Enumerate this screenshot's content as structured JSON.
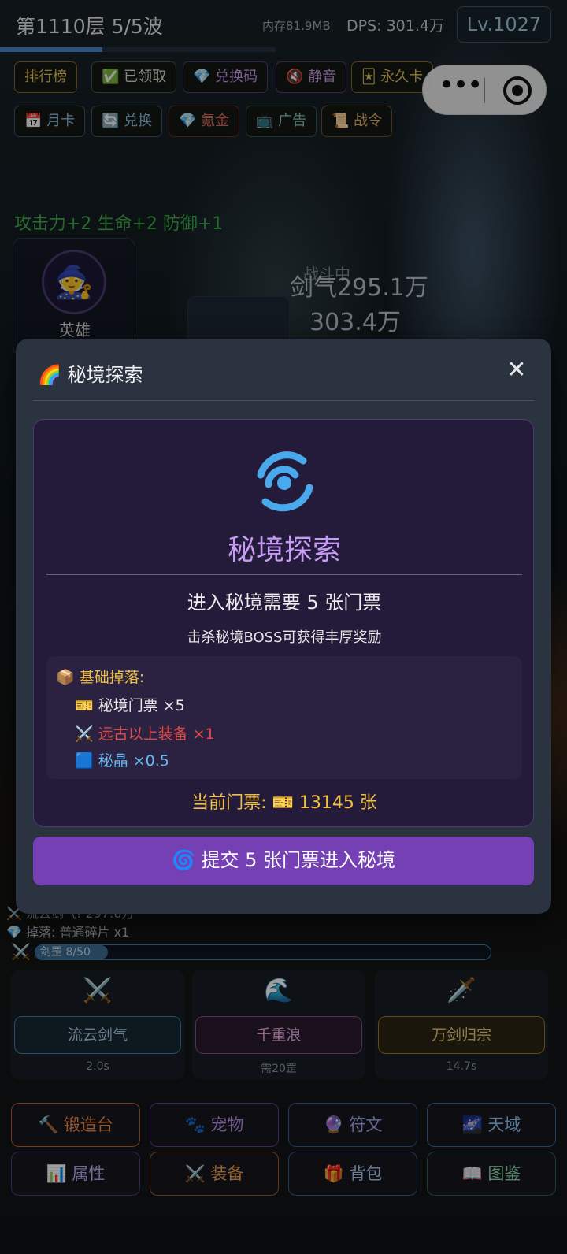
{
  "header": {
    "floor": "第1110层  5/5波",
    "memory": "内存81.9MB",
    "dps": "DPS: 301.4万",
    "level": "Lv.1027",
    "wave_progress": 0.37
  },
  "toolbar_row1": [
    {
      "label": "排行榜",
      "icon": ""
    },
    {
      "label": "已领取",
      "icon": "✅"
    },
    {
      "label": "兑换码",
      "icon": "💎"
    },
    {
      "label": "静音",
      "icon": "🔇"
    },
    {
      "label": "永久卡",
      "icon": "🃏"
    }
  ],
  "toolbar_row2": [
    {
      "label": "月卡",
      "icon": "📅"
    },
    {
      "label": "兑换",
      "icon": "🔄"
    },
    {
      "label": "氪金",
      "icon": "💎"
    },
    {
      "label": "广告",
      "icon": "📺"
    },
    {
      "label": "战令",
      "icon": "📜"
    }
  ],
  "mini_program": {
    "more_icon": "more-dots-icon",
    "close_icon": "record-circle-icon"
  },
  "battle": {
    "buff_text": "攻击力+2 生命+2 防御+1",
    "hero_label": "英雄",
    "status": "战斗中",
    "damage_1": "剑气295.1万",
    "damage_2": "303.4万"
  },
  "combat_log": [
    "流云剑气! 297.6万",
    "掉落: 普通碎片 x1"
  ],
  "rage": {
    "label": "剑罡 8/50",
    "fill": 0.16
  },
  "skills": [
    {
      "name": "流云剑气",
      "cooldown": "2.0s",
      "icon": "⚔️",
      "color": "#3b7fae"
    },
    {
      "name": "千重浪",
      "cooldown": "需20罡",
      "icon": "🌊",
      "color": "#8a4d8a"
    },
    {
      "name": "万剑归宗",
      "cooldown": "14.7s",
      "icon": "🗡️",
      "color": "#a0782a"
    }
  ],
  "bottom_nav": [
    {
      "label": "锻造台",
      "icon": "🔨",
      "color": "#c0602a"
    },
    {
      "label": "宠物",
      "icon": "🐾",
      "color": "#6a3a9a"
    },
    {
      "label": "符文",
      "icon": "🔮",
      "color": "#3a5a9a"
    },
    {
      "label": "天域",
      "icon": "🌌",
      "color": "#3a6a9a"
    },
    {
      "label": "属性",
      "icon": "📊",
      "color": "#4a3a8a"
    },
    {
      "label": "装备",
      "icon": "⚔️",
      "color": "#a05a20"
    },
    {
      "label": "背包",
      "icon": "🎁",
      "color": "#3a5a8a"
    },
    {
      "label": "图鉴",
      "icon": "📖",
      "color": "#2a6a4a"
    }
  ],
  "modal": {
    "title_icon": "🌈",
    "title": "秘境探索",
    "close": "✕",
    "heading": "秘境探索",
    "requirement": "进入秘境需要 5 张门票",
    "hint": "击杀秘境BOSS可获得丰厚奖励",
    "drops_header": "📦 基础掉落:",
    "drops": [
      {
        "text": "🎫 秘境门票 ×5",
        "color": "#e8e8e8"
      },
      {
        "text": "⚔️ 远古以上装备 ×1",
        "color": "#e04848"
      },
      {
        "text": "🟦 秘晶 ×0.5",
        "color": "#66b8f0"
      }
    ],
    "current_tickets": "当前门票: 🎫 13145 张",
    "submit": "🌀 提交 5 张门票进入秘境"
  },
  "colors": {
    "accent": "#7440b4",
    "modal_bg": "#2b3340",
    "inner_bg": "#241a3a",
    "gold": "#f0c040"
  }
}
